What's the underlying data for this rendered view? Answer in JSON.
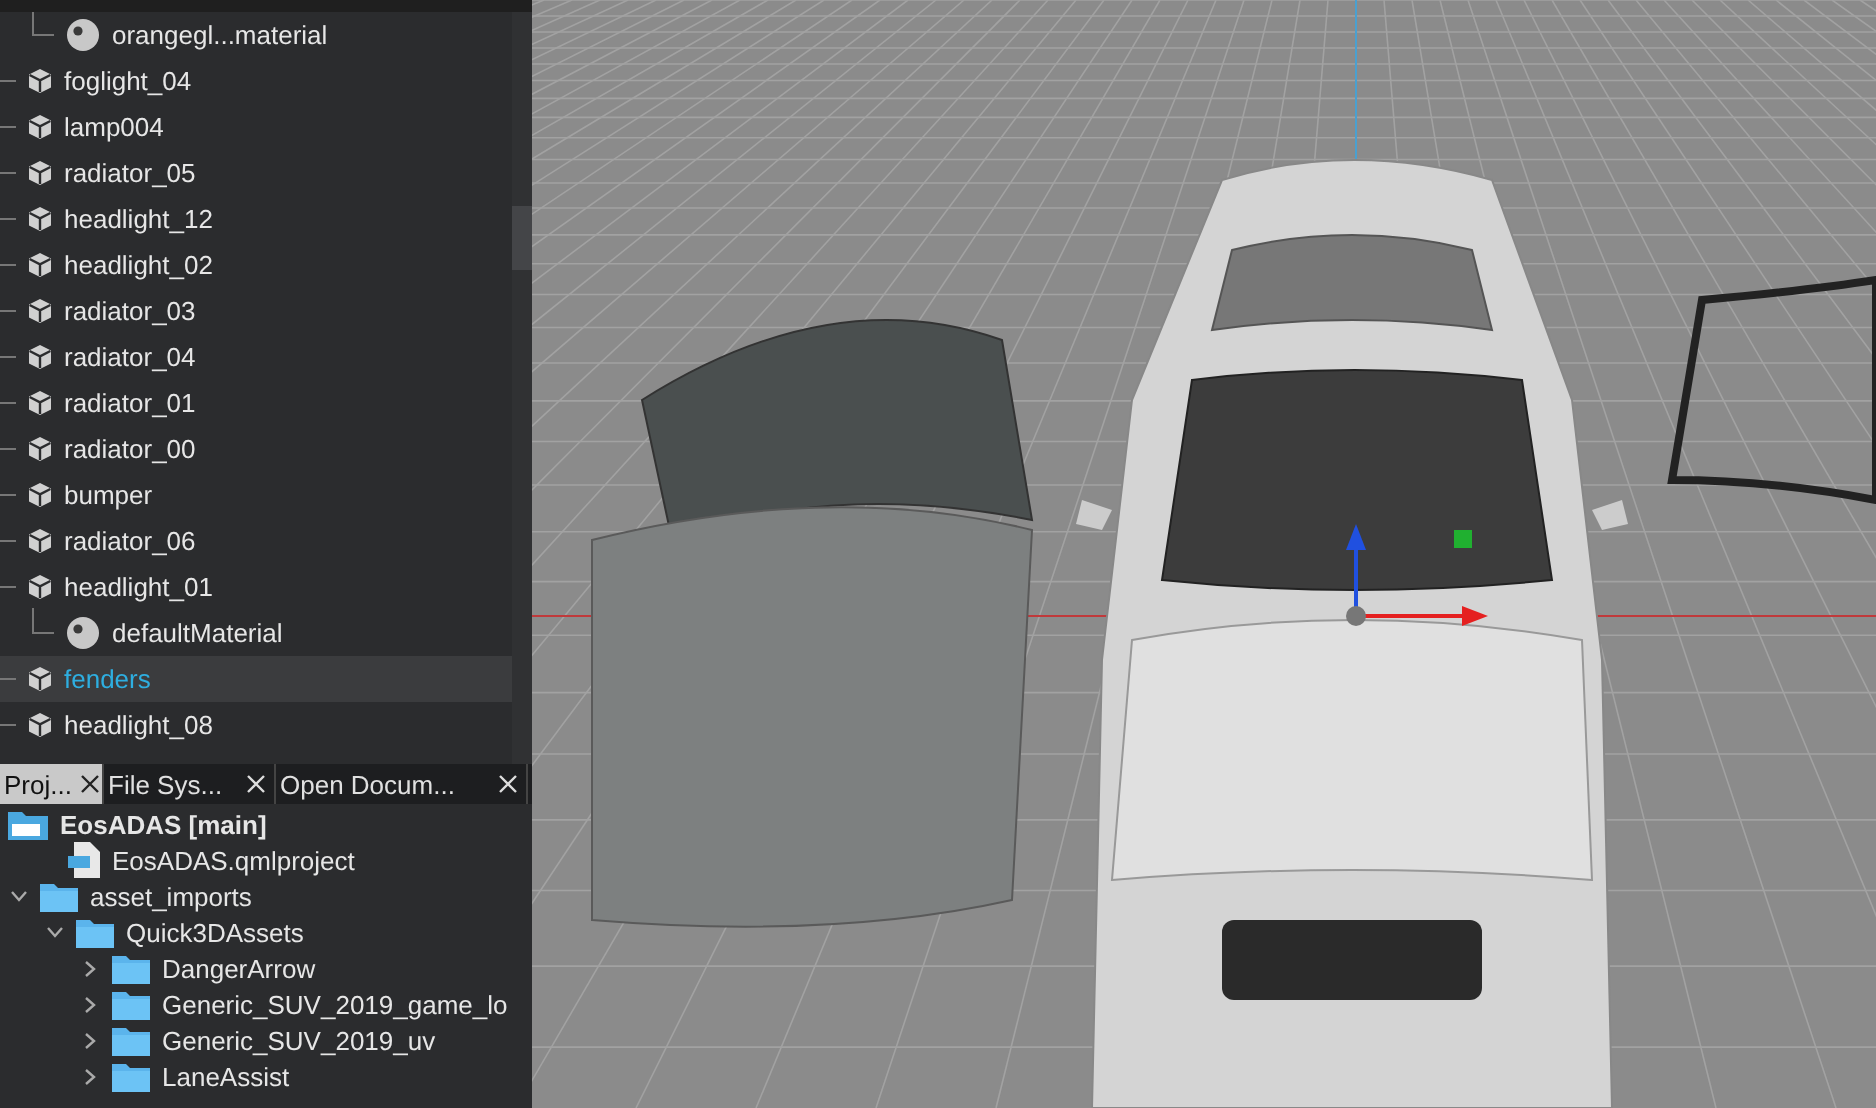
{
  "scene_tree": {
    "items": [
      {
        "label": "orangegl...material",
        "kind": "material",
        "selected": false
      },
      {
        "label": "foglight_04",
        "kind": "mesh",
        "selected": false
      },
      {
        "label": "lamp004",
        "kind": "mesh",
        "selected": false
      },
      {
        "label": "radiator_05",
        "kind": "mesh",
        "selected": false
      },
      {
        "label": "headlight_12",
        "kind": "mesh",
        "selected": false
      },
      {
        "label": "headlight_02",
        "kind": "mesh",
        "selected": false
      },
      {
        "label": "radiator_03",
        "kind": "mesh",
        "selected": false
      },
      {
        "label": "radiator_04",
        "kind": "mesh",
        "selected": false
      },
      {
        "label": "radiator_01",
        "kind": "mesh",
        "selected": false
      },
      {
        "label": "radiator_00",
        "kind": "mesh",
        "selected": false
      },
      {
        "label": "bumper",
        "kind": "mesh",
        "selected": false
      },
      {
        "label": "radiator_06",
        "kind": "mesh",
        "selected": false
      },
      {
        "label": "headlight_01",
        "kind": "mesh",
        "selected": false,
        "children": [
          {
            "label": "defaultMaterial",
            "kind": "material",
            "selected": false
          }
        ]
      },
      {
        "label": "fenders",
        "kind": "mesh",
        "selected": true
      },
      {
        "label": "headlight_08",
        "kind": "mesh",
        "selected": false
      }
    ]
  },
  "tabs": [
    {
      "label": "Proj...",
      "selected": true
    },
    {
      "label": "File Sys...",
      "selected": false
    },
    {
      "label": "Open Docum...",
      "selected": false
    }
  ],
  "project_tree": {
    "items": [
      {
        "label": "EosADAS [main]",
        "kind": "project",
        "children": [
          {
            "label": "EosADAS.qmlproject",
            "kind": "file"
          },
          {
            "label": "asset_imports",
            "kind": "folder",
            "expanded": true,
            "children": [
              {
                "label": "Quick3DAssets",
                "kind": "folder",
                "expanded": true,
                "children": [
                  {
                    "label": "DangerArrow",
                    "kind": "folder",
                    "expanded": false
                  },
                  {
                    "label": "Generic_SUV_2019_game_lo",
                    "kind": "folder",
                    "expanded": false
                  },
                  {
                    "label": "Generic_SUV_2019_uv",
                    "kind": "folder",
                    "expanded": false
                  },
                  {
                    "label": "LaneAssist",
                    "kind": "folder",
                    "expanded": false
                  }
                ]
              }
            ]
          }
        ]
      }
    ]
  }
}
